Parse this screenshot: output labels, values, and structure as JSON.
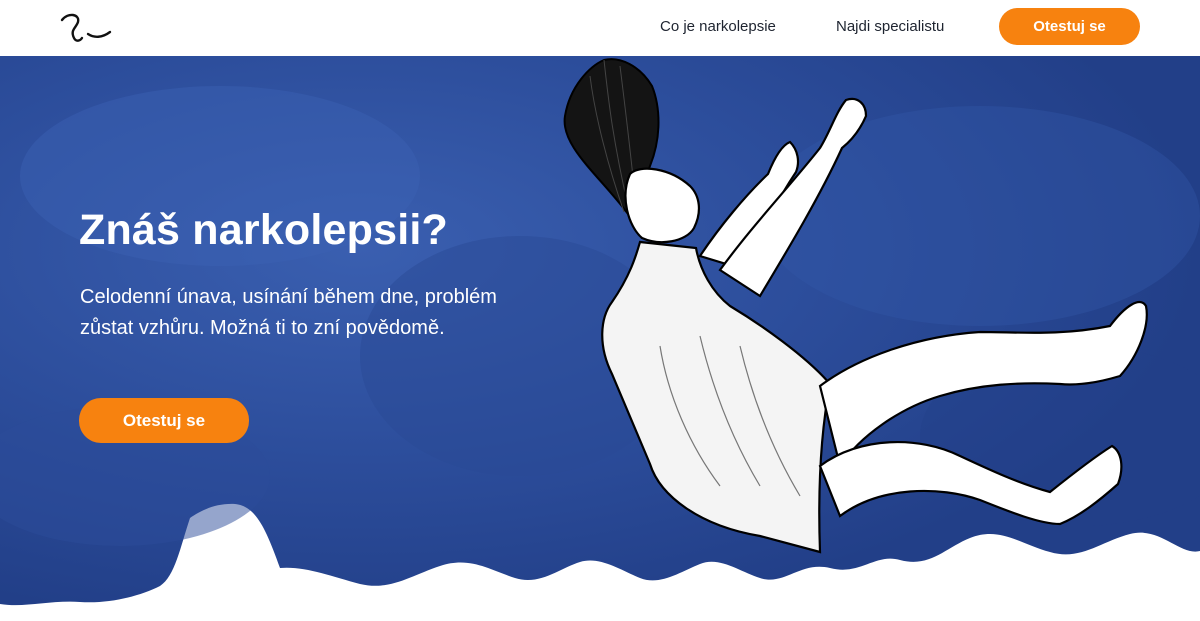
{
  "colors": {
    "accent": "#f7820f",
    "hero_blue": "#2e4f9c",
    "nav_text": "#1e2430"
  },
  "header": {
    "logo_icon": "sleep-face-logo-icon",
    "nav": [
      {
        "label": "Co je narkolepsie"
      },
      {
        "label": "Najdi specialistu"
      }
    ],
    "cta_label": "Otestuj se"
  },
  "hero": {
    "title": "Znáš narkolepsii?",
    "subtitle": "Celodenní únava, usínání během dne, problém zůstat vzhůru. Možná ti to zní povědomě.",
    "cta_label": "Otestuj se",
    "illustration_icon": "falling-woman-illustration"
  }
}
